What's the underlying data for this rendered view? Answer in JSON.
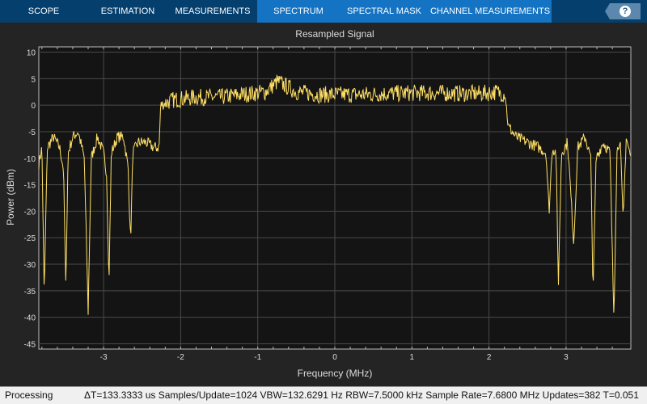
{
  "tabs": [
    {
      "label": "SCOPE",
      "active": false
    },
    {
      "label": "ESTIMATION",
      "active": false
    },
    {
      "label": "MEASUREMENTS",
      "active": false
    },
    {
      "label": "SPECTRUM",
      "active": true
    },
    {
      "label": "SPECTRAL MASK",
      "active": true
    },
    {
      "label": "CHANNEL MEASUREMENTS",
      "active": true
    }
  ],
  "help_label": "?",
  "status": {
    "state": "Processing",
    "info": "ΔT=133.3333 us  Samples/Update=1024  VBW=132.6291 Hz  RBW=7.5000 kHz  Sample Rate=7.6800 MHz  Updates=382  T=0.051"
  },
  "colors": {
    "trace": "#ffe066",
    "plot_bg": "#141414",
    "grid": "#4a4a4a",
    "tab_bar": "#043f6e",
    "tab_active": "#1473c2"
  },
  "chart_data": {
    "type": "line",
    "title": "Resampled Signal",
    "xlabel": "Frequency (MHz)",
    "ylabel": "Power (dBm)",
    "xlim": [
      -3.84,
      3.84
    ],
    "ylim": [
      -46,
      11
    ],
    "grid": true,
    "xticks": [
      -3,
      -2,
      -1,
      0,
      1,
      2,
      3
    ],
    "yticks": [
      10,
      5,
      0,
      -5,
      -10,
      -15,
      -20,
      -25,
      -30,
      -35,
      -40,
      -45
    ],
    "series": [
      {
        "name": "Resampled Signal",
        "x": [
          -3.84,
          -3.8,
          -3.77,
          -3.73,
          -3.65,
          -3.57,
          -3.52,
          -3.49,
          -3.46,
          -3.4,
          -3.33,
          -3.25,
          -3.2,
          -3.16,
          -3.08,
          -3.0,
          -2.96,
          -2.93,
          -2.9,
          -2.82,
          -2.74,
          -2.68,
          -2.65,
          -2.62,
          -2.55,
          -2.45,
          -2.35,
          -2.28,
          -2.26,
          -2.1,
          -1.8,
          -1.5,
          -1.2,
          -0.9,
          -0.74,
          -0.5,
          -0.2,
          0.1,
          0.4,
          0.7,
          1.0,
          1.3,
          1.6,
          1.9,
          2.1,
          2.21,
          2.25,
          2.35,
          2.5,
          2.65,
          2.74,
          2.78,
          2.82,
          2.87,
          2.9,
          2.94,
          3.02,
          3.1,
          3.15,
          3.25,
          3.32,
          3.35,
          3.39,
          3.48,
          3.57,
          3.62,
          3.66,
          3.7,
          3.74,
          3.78,
          3.84
        ],
        "y": [
          -11,
          -8,
          -36,
          -8,
          -6,
          -8,
          -12,
          -34,
          -9,
          -6,
          -5,
          -10,
          -39,
          -10,
          -6,
          -9,
          -13,
          -34,
          -9,
          -6,
          -6,
          -12,
          -26,
          -9,
          -7,
          -7,
          -8,
          -8,
          0,
          1,
          1.5,
          1.5,
          2,
          2.5,
          4.5,
          2.5,
          2,
          2,
          2,
          2.2,
          2.3,
          2.3,
          2.2,
          2.2,
          2.5,
          2,
          -4,
          -6,
          -7,
          -8,
          -9,
          -20,
          -8,
          -9,
          -34,
          -9,
          -7,
          -26,
          -8,
          -6,
          -10,
          -35,
          -10,
          -7,
          -9,
          -40,
          -9,
          -6,
          -22,
          -6,
          -10
        ]
      }
    ]
  }
}
